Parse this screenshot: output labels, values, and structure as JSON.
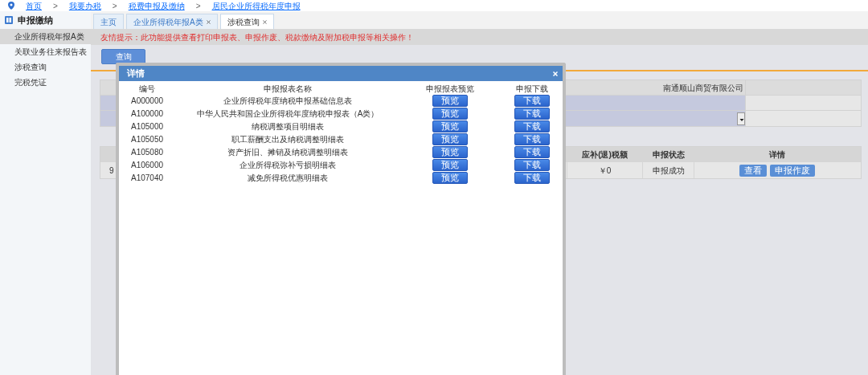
{
  "breadcrumb": [
    {
      "label": "首页"
    },
    {
      "separator": ">",
      "label": "我要办税"
    },
    {
      "separator": ">",
      "label": "税费申报及缴纳"
    },
    {
      "separator": ">",
      "label": "居民企业所得税年度申报"
    }
  ],
  "sidebar": {
    "title": "申报缴纳",
    "items": [
      {
        "label": "企业所得税年报A类",
        "selected": true
      },
      {
        "label": "关联业务往来报告表",
        "selected": false
      },
      {
        "label": "涉税查询",
        "selected": false
      },
      {
        "label": "完税凭证",
        "selected": false
      }
    ]
  },
  "tabs": [
    {
      "label": "主页",
      "selected": false,
      "closable": false
    },
    {
      "label": "企业所得税年报A类",
      "selected": false,
      "closable": true
    },
    {
      "label": "涉税查询",
      "selected": true,
      "closable": true
    }
  ],
  "notice": "友情提示：此功能提供查看打印申报表、申报作废、税款缴纳及附加税申报等相关操作！",
  "query_button": "查询",
  "form": {
    "company": "南通顺山商贸有限公司"
  },
  "results": {
    "columns": [
      "应补(退)税额",
      "申报状态",
      "详情"
    ],
    "rows": [
      {
        "column_1": "9",
        "amount": "￥0",
        "status": "申报成功",
        "actions": [
          "查看",
          "申报作废"
        ]
      }
    ]
  },
  "dialog": {
    "title": "详情",
    "columns": [
      "编号",
      "申报报表名称",
      "申报报表预览",
      "申报下载"
    ],
    "rows": [
      {
        "code": "A000000",
        "name": "企业所得税年度纳税申报基础信息表",
        "preview": "预览",
        "download": "下载"
      },
      {
        "code": "A100000",
        "name": "中华人民共和国企业所得税年度纳税申报表（A类）",
        "preview": "预览",
        "download": "下载"
      },
      {
        "code": "A105000",
        "name": "纳税调整项目明细表",
        "preview": "预览",
        "download": "下载"
      },
      {
        "code": "A105050",
        "name": "职工薪酬支出及纳税调整明细表",
        "preview": "预览",
        "download": "下载"
      },
      {
        "code": "A105080",
        "name": "资产折旧、摊销及纳税调整明细表",
        "preview": "预览",
        "download": "下载"
      },
      {
        "code": "A106000",
        "name": "企业所得税弥补亏损明细表",
        "preview": "预览",
        "download": "下载"
      },
      {
        "code": "A107040",
        "name": "减免所得税优惠明细表",
        "preview": "预览",
        "download": "下载"
      }
    ]
  }
}
